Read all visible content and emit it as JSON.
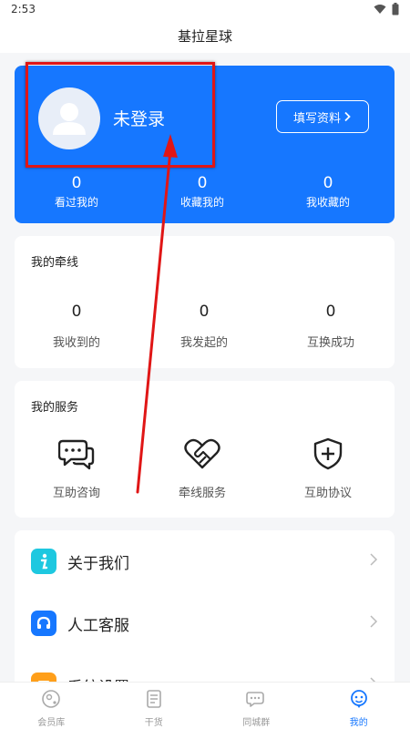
{
  "status_bar": {
    "time": "2:53"
  },
  "app_bar": {
    "title": "基拉星球"
  },
  "profile": {
    "login_status": "未登录",
    "fill_profile_button": "填写资料",
    "stats": [
      {
        "value": "0",
        "label": "看过我的"
      },
      {
        "value": "0",
        "label": "收藏我的"
      },
      {
        "value": "0",
        "label": "我收藏的"
      }
    ]
  },
  "threads": {
    "title": "我的牵线",
    "items": [
      {
        "value": "0",
        "label": "我收到的"
      },
      {
        "value": "0",
        "label": "我发起的"
      },
      {
        "value": "0",
        "label": "互换成功"
      }
    ]
  },
  "services": {
    "title": "我的服务",
    "items": [
      {
        "label": "互助咨询",
        "icon": "chat-bubbles-icon"
      },
      {
        "label": "牵线服务",
        "icon": "handshake-heart-icon"
      },
      {
        "label": "互助协议",
        "icon": "shield-plus-icon"
      }
    ]
  },
  "menu": {
    "items": [
      {
        "label": "关于我们",
        "icon": "info-icon",
        "color": "#1ec8e0"
      },
      {
        "label": "人工客服",
        "icon": "headset-icon",
        "color": "#1677ff"
      },
      {
        "label": "系统设置",
        "icon": "settings-icon",
        "color": "#ff9f1a"
      }
    ]
  },
  "bottom_nav": {
    "items": [
      {
        "label": "会员库",
        "icon": "member-icon"
      },
      {
        "label": "干货",
        "icon": "article-icon"
      },
      {
        "label": "同城群",
        "icon": "group-chat-icon"
      },
      {
        "label": "我的",
        "icon": "mine-icon",
        "active": true
      }
    ]
  },
  "colors": {
    "accent": "#1677ff",
    "annotation": "#e01616"
  }
}
